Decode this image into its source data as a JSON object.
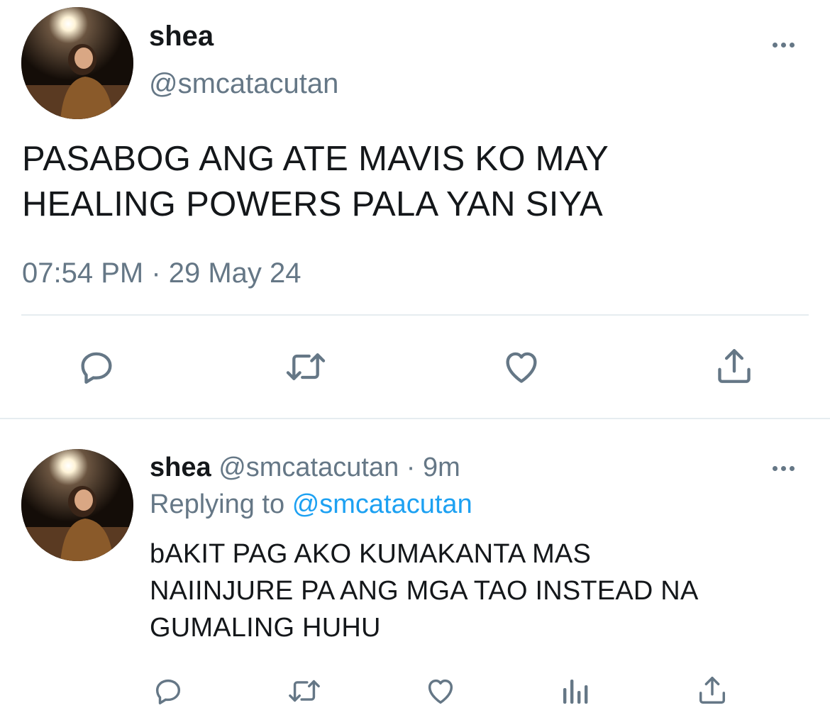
{
  "main_tweet": {
    "display_name": "shea",
    "handle": "@smcatacutan",
    "text_line1": "PASABOG ANG ATE MAVIS KO MAY",
    "text_line2": "HEALING POWERS PALA YAN SIYA",
    "timestamp": "07:54 PM · 29 May 24",
    "actions": [
      "reply-icon",
      "retweet-icon",
      "like-icon",
      "share-icon"
    ]
  },
  "reply_tweet": {
    "display_name": "shea",
    "handle": "@smcatacutan",
    "time": "9m",
    "replying_label": "Replying to",
    "replying_to": "@smcatacutan",
    "text_line1": "bAKIT PAG AKO KUMAKANTA MAS",
    "text_line2": "NAIINJURE PA ANG MGA TAO INSTEAD NA",
    "text_line3": "GUMALING HUHU",
    "actions": [
      "reply-icon",
      "retweet-icon",
      "like-icon",
      "analytics-icon",
      "share-icon"
    ]
  },
  "colors": {
    "text": "#14171a",
    "muted": "#657786",
    "link": "#1da1f2",
    "divider": "#e6ecf0"
  }
}
